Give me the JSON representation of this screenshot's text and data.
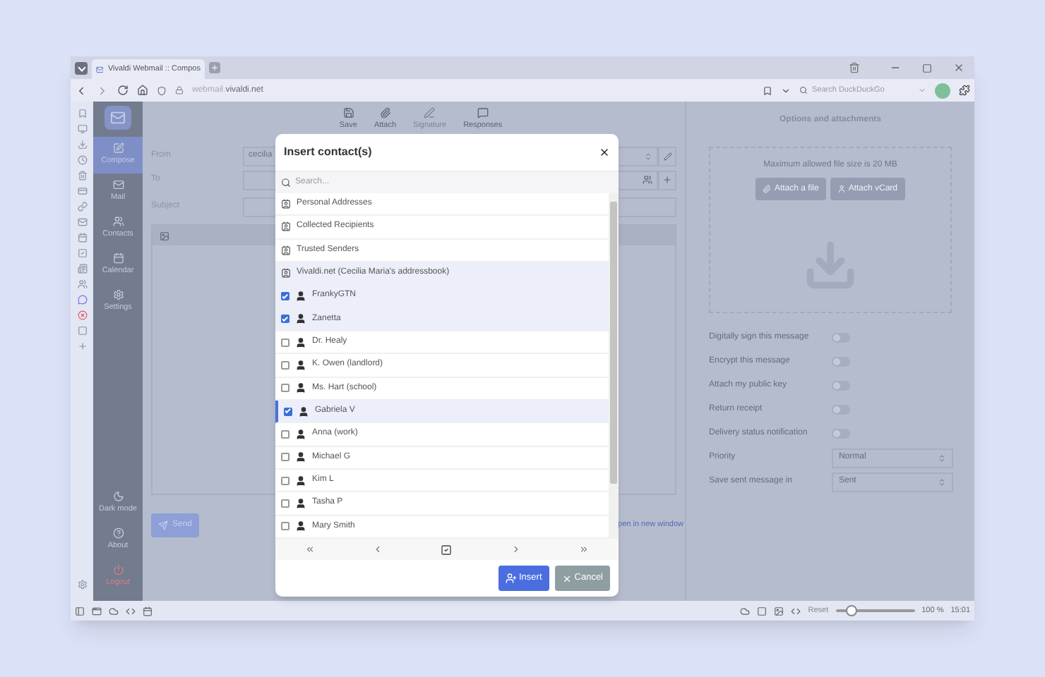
{
  "browser": {
    "tab_title": "Vivaldi Webmail :: Compos",
    "url_prefix": "webmail.",
    "url_domain": "vivaldi.net",
    "search_placeholder": "Search DuckDuckGo"
  },
  "nav": {
    "items": [
      {
        "label": "Compose",
        "selected": true
      },
      {
        "label": "Mail",
        "selected": false
      },
      {
        "label": "Contacts",
        "selected": false
      },
      {
        "label": "Calendar",
        "selected": false
      },
      {
        "label": "Settings",
        "selected": false
      }
    ],
    "bottom": [
      {
        "label": "Dark mode",
        "kind": "moon"
      },
      {
        "label": "About",
        "kind": "help"
      },
      {
        "label": "Logout",
        "kind": "logout"
      }
    ]
  },
  "toolbar": [
    {
      "label": "Save",
      "disabled": false
    },
    {
      "label": "Attach",
      "disabled": false
    },
    {
      "label": "Signature",
      "disabled": true
    },
    {
      "label": "Responses",
      "disabled": false
    }
  ],
  "form": {
    "from_label": "From",
    "from_value": "cecilia",
    "to_label": "To",
    "subject_label": "Subject",
    "send": "Send",
    "open_link": "pen in new window"
  },
  "options": {
    "title": "Options and attachments",
    "max_size": "Maximum allowed file size is 20 MB",
    "attach_file": "Attach a file",
    "attach_vcard": "Attach vCard",
    "toggles": [
      {
        "label": "Digitally sign this message",
        "on": false
      },
      {
        "label": "Encrypt this message",
        "on": false
      },
      {
        "label": "Attach my public key",
        "on": false
      },
      {
        "label": "Return receipt",
        "on": false
      },
      {
        "label": "Delivery status notification",
        "on": false
      }
    ],
    "selects": [
      {
        "label": "Priority",
        "value": "Normal"
      },
      {
        "label": "Save sent message in",
        "value": "Sent"
      }
    ]
  },
  "dialog": {
    "title": "Insert contact(s)",
    "search_placeholder": "Search...",
    "items": [
      {
        "kind": "addressbook",
        "name": "Personal Addresses",
        "selected": false
      },
      {
        "kind": "addressbook",
        "name": "Collected Recipients",
        "selected": false
      },
      {
        "kind": "addressbook",
        "name": "Trusted Senders",
        "selected": false
      },
      {
        "kind": "addressbook",
        "name": "Vivaldi.net (Cecilia Maria's addressbook)",
        "selected": true
      },
      {
        "kind": "contact",
        "name": "FrankyGTN",
        "checked": true,
        "focused": false
      },
      {
        "kind": "contact",
        "name": "Zanetta",
        "checked": true,
        "focused": false
      },
      {
        "kind": "contact",
        "name": "Dr. Healy",
        "checked": false,
        "focused": false
      },
      {
        "kind": "contact",
        "name": "K. Owen (landlord)",
        "checked": false,
        "focused": false
      },
      {
        "kind": "contact",
        "name": "Ms. Hart (school)",
        "checked": false,
        "focused": false
      },
      {
        "kind": "contact",
        "name": "Gabriela V",
        "checked": true,
        "focused": true
      },
      {
        "kind": "contact",
        "name": "Anna (work)",
        "checked": false,
        "focused": false
      },
      {
        "kind": "contact",
        "name": "Michael G",
        "checked": false,
        "focused": false
      },
      {
        "kind": "contact",
        "name": "Kim L",
        "checked": false,
        "focused": false
      },
      {
        "kind": "contact",
        "name": "Tasha P",
        "checked": false,
        "focused": false
      },
      {
        "kind": "contact",
        "name": "Mary Smith",
        "checked": false,
        "focused": false
      }
    ],
    "insert": "Insert",
    "cancel": "Cancel"
  },
  "status_bar": {
    "reset": "Reset",
    "zoom_slider": {
      "level": 0.2
    },
    "zoom": "100 %",
    "time": "15:01"
  }
}
